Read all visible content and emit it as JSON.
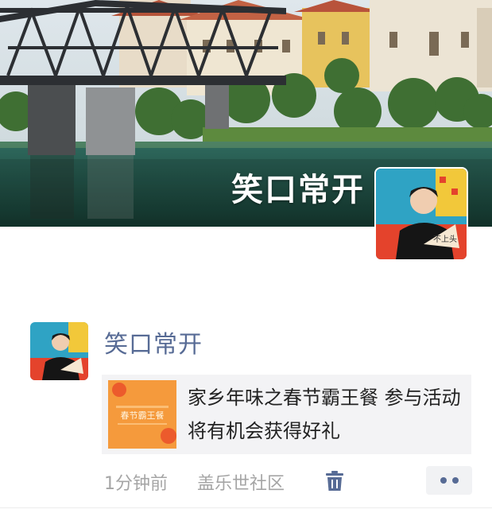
{
  "cover": {
    "name": "笑口常开",
    "background": "bridge-and-lake-photo"
  },
  "post": {
    "author": "笑口常开",
    "avatar": "person-holding-fan-photo",
    "share": {
      "thumb_text": "春节霸王餐",
      "title": "家乡年味之春节霸王餐 参与活动将有机会获得好礼"
    },
    "time": "1分钟前",
    "location": "盖乐世社区",
    "delete_icon": "trash-icon",
    "more_icon": "more-dots-icon"
  },
  "colors": {
    "link": "#576b95",
    "meta": "#a5a5a5",
    "card_bg": "#f3f3f5",
    "thumb_orange": "#f59a3c"
  }
}
